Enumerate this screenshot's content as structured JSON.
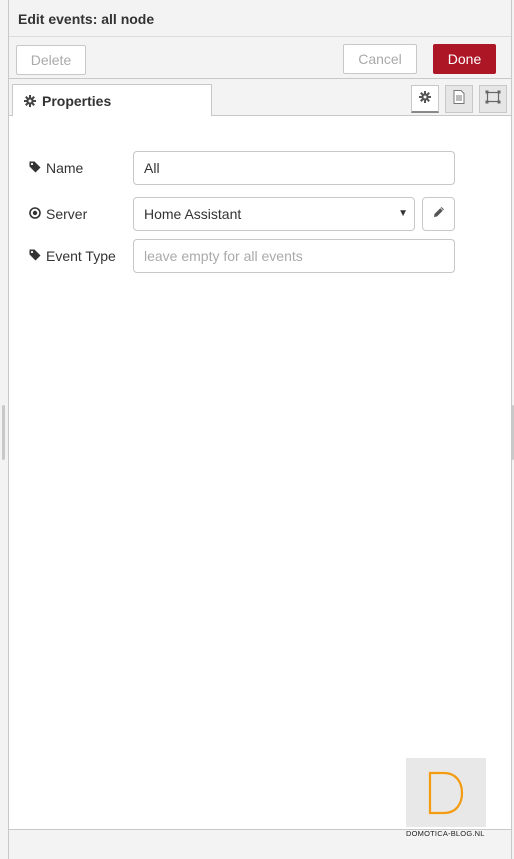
{
  "tray": {
    "title": "Edit events: all node"
  },
  "toolbar": {
    "delete_label": "Delete",
    "cancel_label": "Cancel",
    "done_label": "Done",
    "done_color": "#ad1625"
  },
  "tabs": {
    "properties_label": "Properties",
    "icons": [
      "gear-icon",
      "file-text-icon",
      "appearance-icon"
    ]
  },
  "form": {
    "name": {
      "label": "Name",
      "value": "All",
      "icon": "tag-icon"
    },
    "server": {
      "label": "Server",
      "selected": "Home Assistant",
      "icon": "dot-circle-icon",
      "edit_icon": "pencil-icon"
    },
    "event_type": {
      "label": "Event Type",
      "value": "",
      "placeholder": "leave empty for all events",
      "icon": "tag-icon"
    }
  },
  "watermark": {
    "logo_letter": "D",
    "logo_color": "#f39c12",
    "caption": "DOMOTICA-BLOG.NL"
  }
}
